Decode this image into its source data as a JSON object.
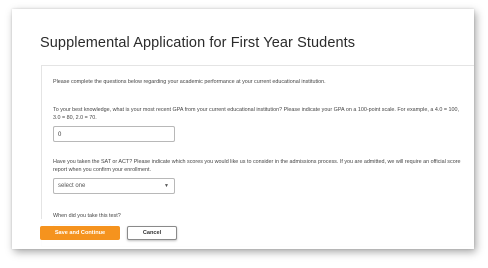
{
  "page": {
    "title": "Supplemental Application for First Year Students",
    "intro": "Please complete the questions below regarding your academic performance at your current educational institution."
  },
  "questions": {
    "gpa": {
      "label": "To your best knowledge, what is your most recent GPA from your current educational institution? Please indicate your GPA on a 100-point scale. For example, a 4.0 = 100, 3.0 = 80, 2.0 = 70.",
      "value": "0"
    },
    "tests": {
      "label": "Have you taken the SAT or ACT? Please indicate which scores you would like us to consider in the admissions process. If you are admitted, we will require an official score report when you confirm your enrollment.",
      "selected": "select one"
    },
    "test_date": {
      "label": "When did you take this test?"
    }
  },
  "footer": {
    "primary_label": "Save and Continue",
    "secondary_label": "Cancel"
  },
  "colors": {
    "primary_button": "#f5931e",
    "title_text": "#2b2b2b"
  },
  "icons": {
    "select": "chevron-down-icon"
  }
}
